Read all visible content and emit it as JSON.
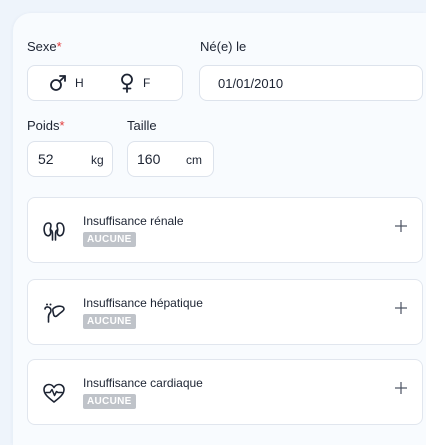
{
  "form": {
    "sex": {
      "label": "Sexe",
      "required_mark": "*",
      "options": [
        {
          "icon": "male-symbol-icon",
          "label": "H"
        },
        {
          "icon": "female-symbol-icon",
          "label": "F"
        }
      ]
    },
    "birthdate": {
      "label": "Né(e) le",
      "value": "01/01/2010"
    },
    "weight": {
      "label": "Poids",
      "required_mark": "*",
      "value": "52",
      "unit": "kg"
    },
    "height": {
      "label": "Taille",
      "value": "160",
      "unit": "cm"
    }
  },
  "conditions": [
    {
      "icon": "kidneys-icon",
      "title": "Insuffisance rénale",
      "status": "AUCUNE",
      "action_icon": "plus-icon"
    },
    {
      "icon": "liver-icon",
      "title": "Insuffisance hépatique",
      "status": "AUCUNE",
      "action_icon": "plus-icon"
    },
    {
      "icon": "heart-pulse-icon",
      "title": "Insuffisance cardiaque",
      "status": "AUCUNE",
      "action_icon": "plus-icon"
    }
  ],
  "colors": {
    "required": "#e23b3b",
    "badge_bg": "#bfc3c9",
    "page_bg": "#eef4fb",
    "card_bg": "#f8fbfe",
    "border": "#dde3ec",
    "text": "#1d2433"
  }
}
